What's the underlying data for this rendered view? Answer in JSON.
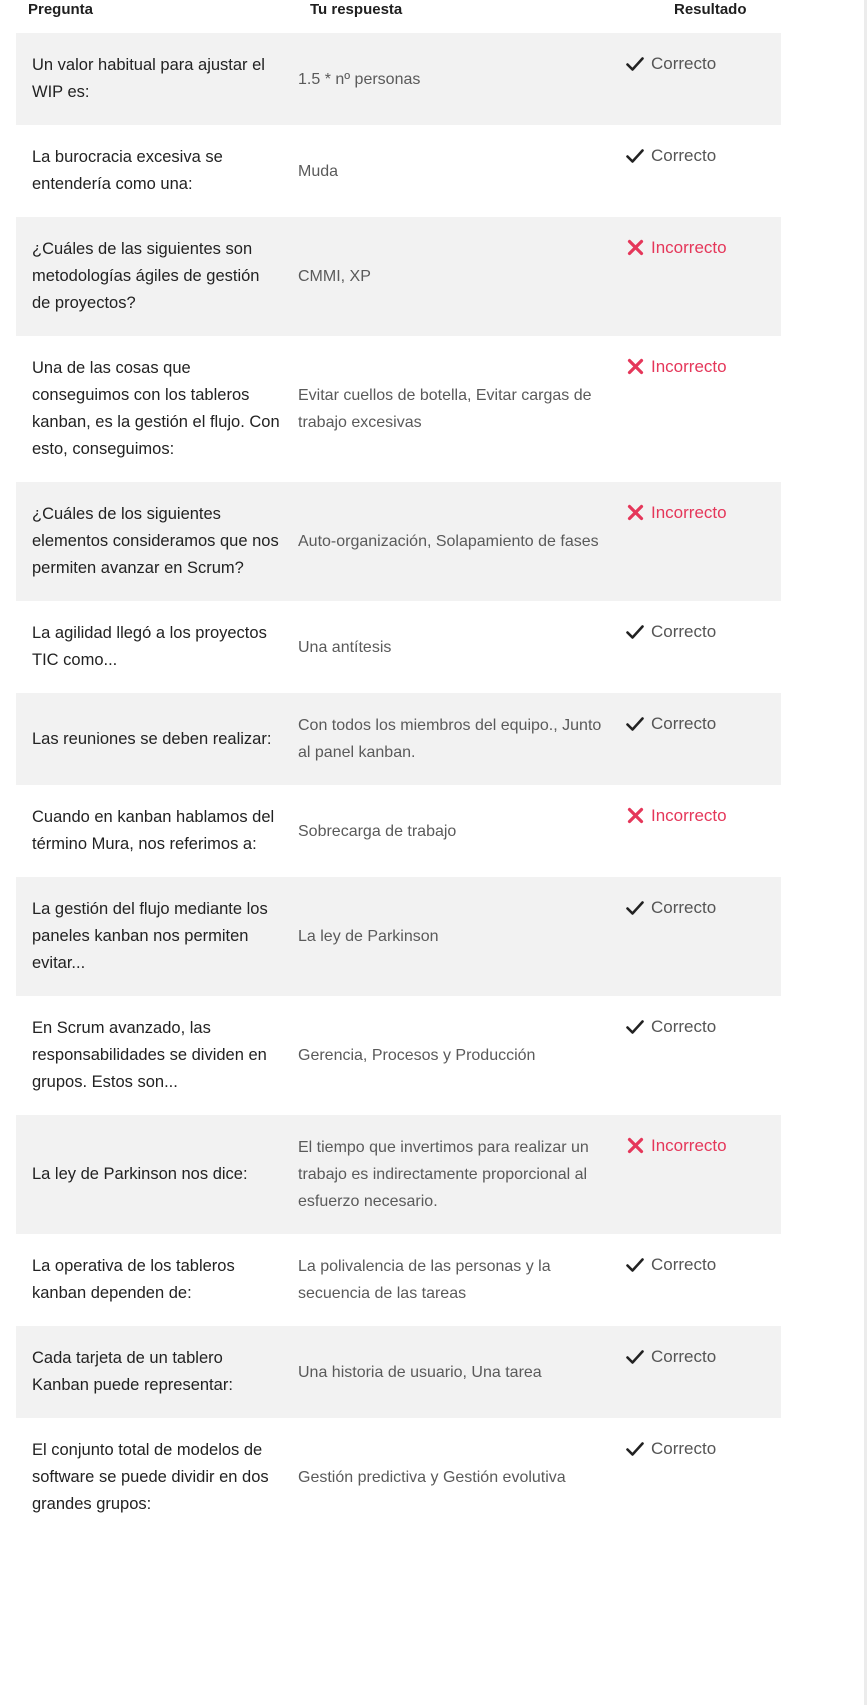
{
  "header": {
    "question": "Pregunta",
    "answer": "Tu respuesta",
    "result": "Resultado"
  },
  "colors": {
    "correct": "#555555",
    "incorrect": "#e5375a",
    "row_shade": "#f2f2f2"
  },
  "rows": [
    {
      "question": "Un valor habitual para ajustar el WIP es:",
      "answer": "1.5 * nº personas",
      "result": "Correcto",
      "status": "correct",
      "icon": "check-icon"
    },
    {
      "question": "La burocracia excesiva se entendería como una:",
      "answer": "Muda",
      "result": "Correcto",
      "status": "correct",
      "icon": "check-icon"
    },
    {
      "question": "¿Cuáles de las siguientes son metodologías ágiles de gestión de proyectos?",
      "answer": "CMMI, XP",
      "result": "Incorrecto",
      "status": "incorrect",
      "icon": "cross-icon"
    },
    {
      "question": "Una de las cosas que conseguimos con los tableros kanban, es la gestión el flujo. Con esto, conseguimos:",
      "answer": "Evitar cuellos de botella, Evitar cargas de trabajo excesivas",
      "result": "Incorrecto",
      "status": "incorrect",
      "icon": "cross-icon"
    },
    {
      "question": "¿Cuáles de los siguientes elementos consideramos que nos permiten avanzar en Scrum?",
      "answer": "Auto-organización, Solapamiento de fases",
      "result": "Incorrecto",
      "status": "incorrect",
      "icon": "cross-icon"
    },
    {
      "question": "La agilidad llegó a los proyectos TIC como...",
      "answer": "Una antítesis",
      "result": "Correcto",
      "status": "correct",
      "icon": "check-icon"
    },
    {
      "question": "Las reuniones se deben realizar:",
      "answer": "Con todos los miembros del equipo., Junto al panel kanban.",
      "result": "Correcto",
      "status": "correct",
      "icon": "check-icon"
    },
    {
      "question": "Cuando en kanban hablamos del término Mura, nos referimos a:",
      "answer": "Sobrecarga de trabajo",
      "result": "Incorrecto",
      "status": "incorrect",
      "icon": "cross-icon"
    },
    {
      "question": "La gestión del flujo mediante los paneles kanban nos permiten evitar...",
      "answer": "La ley de Parkinson",
      "result": "Correcto",
      "status": "correct",
      "icon": "check-icon"
    },
    {
      "question": "En Scrum avanzado, las responsabilidades se dividen en grupos. Estos son...",
      "answer": "Gerencia, Procesos y Producción",
      "result": "Correcto",
      "status": "correct",
      "icon": "check-icon"
    },
    {
      "question": "La ley de Parkinson nos dice:",
      "answer": "El tiempo que invertimos para realizar un trabajo es indirectamente proporcional al esfuerzo necesario.",
      "result": "Incorrecto",
      "status": "incorrect",
      "icon": "cross-icon"
    },
    {
      "question": "La operativa de los tableros kanban dependen de:",
      "answer": "La polivalencia de las personas y la secuencia de las tareas",
      "result": "Correcto",
      "status": "correct",
      "icon": "check-icon"
    },
    {
      "question": "Cada tarjeta de un tablero Kanban puede representar:",
      "answer": "Una historia de usuario, Una tarea",
      "result": "Correcto",
      "status": "correct",
      "icon": "check-icon"
    },
    {
      "question": "El conjunto total de modelos de software se puede dividir en dos grandes grupos:",
      "answer": "Gestión predictiva y Gestión evolutiva",
      "result": "Correcto",
      "status": "correct",
      "icon": "check-icon"
    }
  ]
}
